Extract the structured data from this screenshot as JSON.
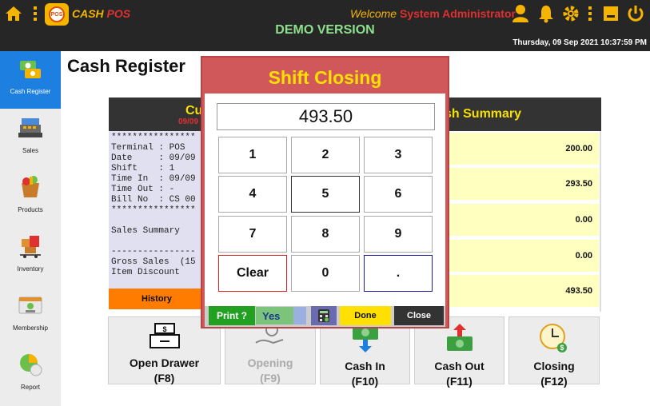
{
  "app": {
    "name_main": "CASH",
    "name_sub": " POS",
    "logo_text": "POS"
  },
  "header": {
    "welcome": "Welcome",
    "user": "System Administrator",
    "edition": "DEMO VERSION",
    "datetime": "Thursday, 09 Sep 2021 10:37:59 PM"
  },
  "colors": {
    "topbar": "#262626",
    "accent": "#f5b400",
    "active": "#1d7fe0",
    "modal": "#d1585a"
  },
  "sidebar": {
    "items": [
      {
        "label": "Cash Register",
        "icon": "cash-register-icon"
      },
      {
        "label": "Sales",
        "icon": "sales-icon"
      },
      {
        "label": "Products",
        "icon": "products-icon"
      },
      {
        "label": "Inventory",
        "icon": "inventory-icon"
      },
      {
        "label": "Membership",
        "icon": "membership-icon"
      },
      {
        "label": "Report",
        "icon": "report-icon"
      }
    ]
  },
  "page": {
    "title": "Cash Register"
  },
  "receipt": {
    "head_title": "Cu",
    "head_date": "09/09",
    "text": "****************\nTerminal : POS\nDate     : 09/09\nShift    : 1\nTime In  : 09/09\nTime Out : -\nBill No  : CS 00\n****************\n\nSales Summary\n\n----------------\nGross Sales  (15\nItem Discount",
    "history_label": "History"
  },
  "summary": {
    "head": "sh Summary",
    "values": [
      "200.00",
      "293.50",
      "0.00",
      "0.00",
      "493.50"
    ]
  },
  "actions": [
    {
      "line1": "Open Drawer",
      "line2": "(F8)",
      "icon": "drawer-icon",
      "enabled": true
    },
    {
      "line1": "Opening",
      "line2": "(F9)",
      "icon": "opening-icon",
      "enabled": false
    },
    {
      "line1": "Cash In",
      "line2": "(F10)",
      "icon": "cash-in-icon",
      "enabled": true
    },
    {
      "line1": "Cash Out",
      "line2": "(F11)",
      "icon": "cash-out-icon",
      "enabled": true
    },
    {
      "line1": "Closing",
      "line2": "(F12)",
      "icon": "closing-icon",
      "enabled": true
    }
  ],
  "modal": {
    "title": "Shift Closing",
    "amount": "493.50",
    "keys": [
      "1",
      "2",
      "3",
      "4",
      "5",
      "6",
      "7",
      "8",
      "9",
      "Clear",
      "0",
      "."
    ],
    "print_label": "Print ?",
    "print_value": "Yes",
    "done_label": "Done",
    "close_label": "Close"
  }
}
